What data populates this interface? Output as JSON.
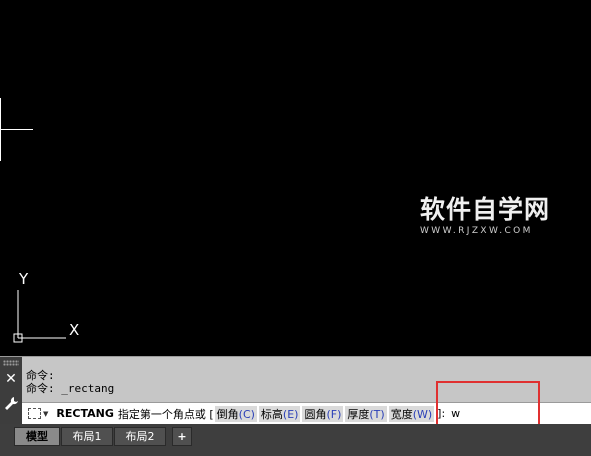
{
  "canvas": {
    "ucs": {
      "y_label": "Y",
      "x_label": "X"
    }
  },
  "watermark": {
    "title": "软件自学网",
    "url": "WWW.RJZXW.COM"
  },
  "command_window": {
    "history": [
      "命令:",
      "命令: _rectang"
    ],
    "prompt": {
      "command": "RECTANG",
      "text": "指定第一个角点或 [",
      "options": [
        {
          "label": "倒角",
          "key": "(C)"
        },
        {
          "label": "标高",
          "key": "(E)"
        },
        {
          "label": "圆角",
          "key": "(F)"
        },
        {
          "label": "厚度",
          "key": "(T)"
        },
        {
          "label": "宽度",
          "key": "(W)"
        }
      ],
      "suffix": "]:",
      "input": "w"
    }
  },
  "layout_tabs": {
    "items": [
      "模型",
      "布局1",
      "布局2"
    ],
    "add": "+"
  },
  "colors": {
    "highlight": "#e03030",
    "option_key": "#2a3fb8"
  }
}
